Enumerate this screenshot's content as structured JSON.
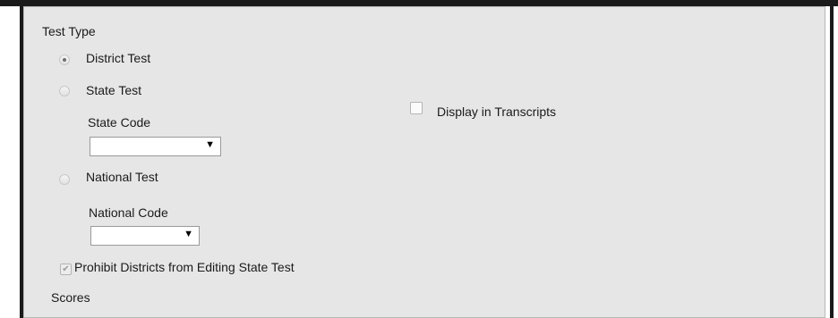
{
  "test_type": {
    "heading": "Test Type",
    "district_test": {
      "label": "District Test",
      "selected": true
    },
    "state_test": {
      "label": "State Test",
      "selected": false
    },
    "state_code": {
      "label": "State Code",
      "value": ""
    },
    "national_test": {
      "label": "National Test",
      "selected": false
    },
    "national_code": {
      "label": "National Code",
      "value": ""
    }
  },
  "display_in_transcripts": {
    "label": "Display in Transcripts",
    "checked": false
  },
  "prohibit_districts": {
    "label": "Prohibit Districts from Editing State Test",
    "checked": true,
    "disabled": true
  },
  "scores_heading": "Scores",
  "icons": {
    "dropdown": "▼",
    "check": "✔"
  }
}
